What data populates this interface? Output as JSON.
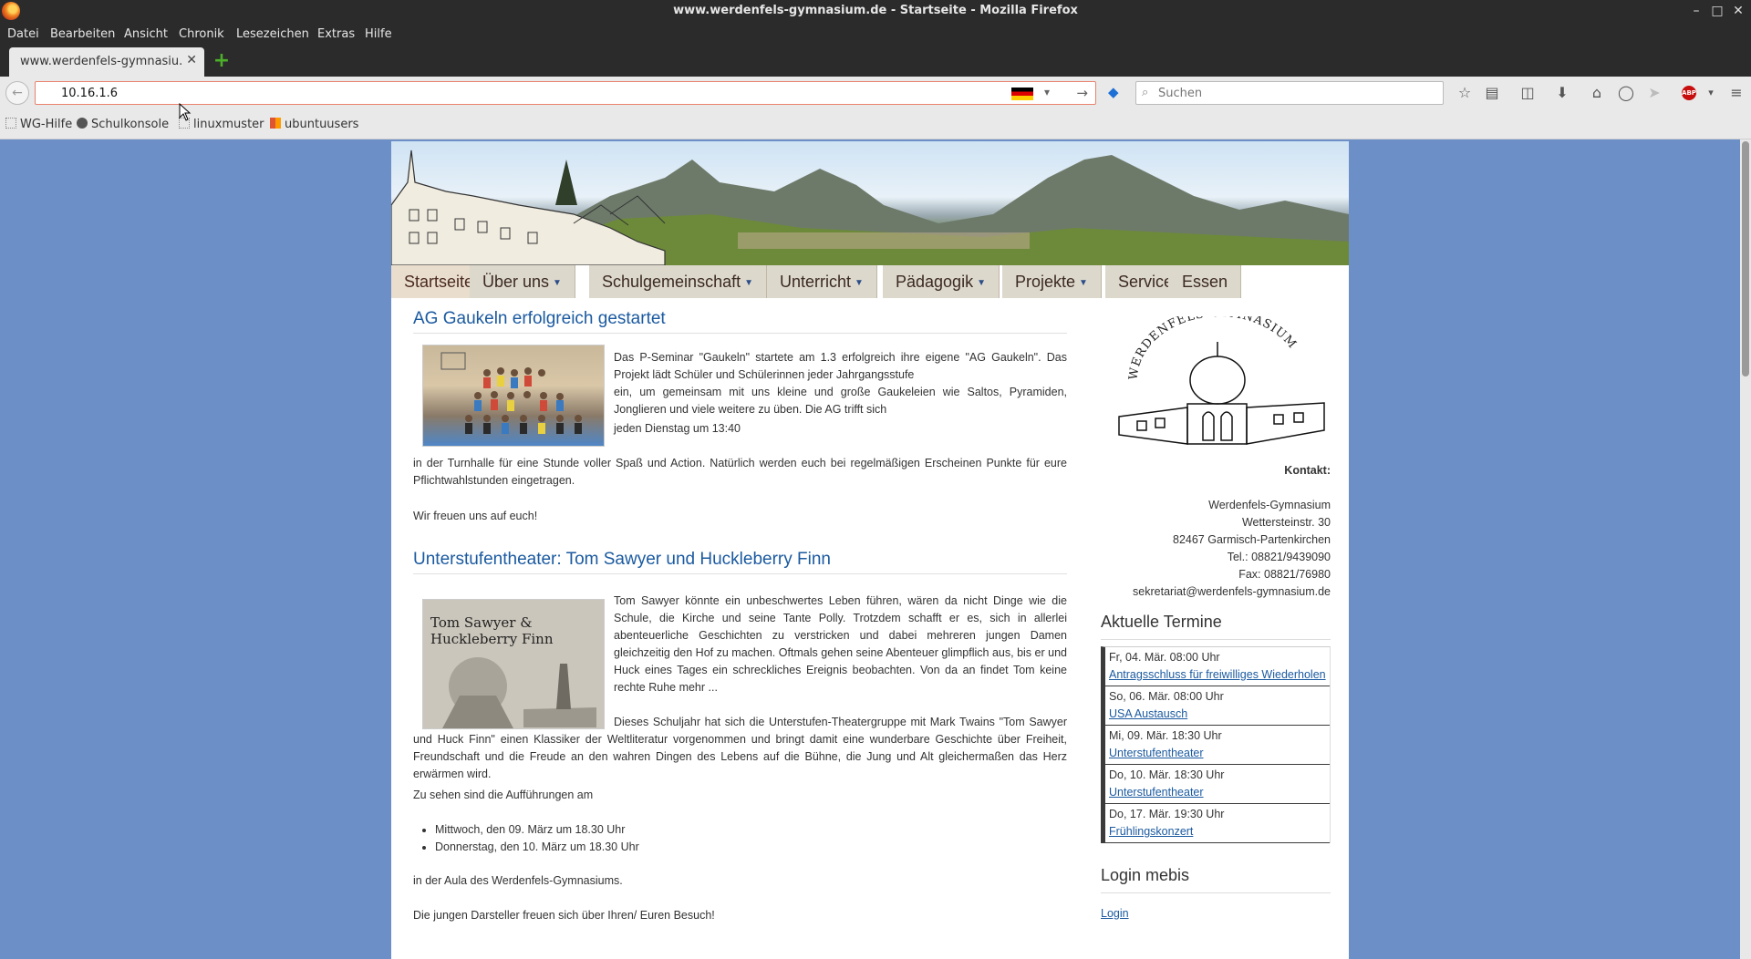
{
  "window": {
    "title": "www.werdenfels-gymnasium.de - Startseite - Mozilla Firefox"
  },
  "menu": [
    "Datei",
    "Bearbeiten",
    "Ansicht",
    "Chronik",
    "Lesezeichen",
    "Extras",
    "Hilfe"
  ],
  "tab": {
    "label": "www.werdenfels-gymnasiu...",
    "close": "✕"
  },
  "urlbar": {
    "value": "10.16.1.6"
  },
  "search": {
    "placeholder": "Suchen"
  },
  "bookmarks": [
    "WG-Hilfe",
    "Schulkonsole",
    "linuxmuster",
    "ubuntuusers"
  ],
  "nav": {
    "items": [
      {
        "label": "Startseite",
        "caret": false
      },
      {
        "label": "Über uns",
        "caret": true
      },
      {
        "label": "Schulgemeinschaft",
        "caret": true
      },
      {
        "label": "Unterricht",
        "caret": true
      },
      {
        "label": "Pädagogik",
        "caret": true
      },
      {
        "label": "Projekte",
        "caret": true
      },
      {
        "label": "Service",
        "caret": true
      },
      {
        "label": "Essen",
        "caret": false
      }
    ]
  },
  "articles": [
    {
      "title": "AG Gaukeln erfolgreich gestartet",
      "p1": "Das P-Seminar \"Gaukeln\" startete am 1.3 erfolgreich ihre eigene \"AG Gaukeln\". Das Projekt lädt Schüler und Schülerinnen jeder Jahrgangsstufe",
      "p2": "ein, um gemeinsam mit uns kleine und große Gaukeleien wie Saltos, Pyramiden, Jonglieren und viele weitere zu üben. Die AG trifft sich",
      "p3": "jeden Dienstag um 13:40",
      "p4": "in der Turnhalle für eine Stunde voller Spaß und Action. Natürlich werden euch bei regelmäßigen Erscheinen Punkte für eure Pflichtwahlstunden eingetragen.",
      "p5": "Wir freuen uns auf euch!"
    },
    {
      "title": "Unterstufentheater: Tom Sawyer und Huckleberry Finn",
      "image_text": "Tom Sawyer & Huckleberry Finn",
      "p1": "Tom Sawyer könnte ein unbeschwertes Leben führen, wären da nicht Dinge wie die Schule, die Kirche und seine Tante Polly. Trotzdem schafft er es, sich in allerlei abenteuerliche Geschichten zu verstricken und dabei mehreren jungen Damen gleichzeitig den Hof zu machen. Oftmals gehen seine Abenteuer glimpflich aus, bis er und Huck eines Tages ein schreckliches Ereignis beobachten. Von da an findet Tom keine rechte Ruhe mehr ...",
      "p2": "Dieses Schuljahr hat sich die Unterstufen-Theatergruppe mit Mark Twains \"Tom Sawyer und Huck Finn\" einen Klassiker der Weltliteratur vorgenommen und bringt damit eine wunderbare Geschichte über Freiheit,  Freundschaft und die Freude an den wahren Dingen des Lebens  auf die Bühne, die Jung und Alt gleichermaßen das Herz erwärmen wird.",
      "p3": "Zu sehen sind die Aufführungen am",
      "list": [
        "Mittwoch,  den 09. März um 18.30 Uhr",
        "Donnerstag, den 10. März um 18.30 Uhr"
      ],
      "p4": "in der Aula des Werdenfels-Gymnasiums.",
      "p5": "Die jungen Darsteller freuen sich über Ihren/ Euren Besuch!"
    }
  ],
  "sidebar": {
    "logo_text": "WERDENFELS-GYMNASIUM",
    "contact_label": "Kontakt:",
    "contact": [
      "Werdenfels-Gymnasium",
      "Wettersteinstr. 30",
      "82467 Garmisch-Partenkirchen",
      "Tel.: 08821/9439090",
      "Fax: 08821/76980",
      "sekretariat@werdenfels-gymnasium.de"
    ],
    "events_title": "Aktuelle Termine",
    "events": [
      {
        "date": "Fr, 04. Mär. 08:00 Uhr",
        "title": "Antragsschluss für freiwilliges Wiederholen"
      },
      {
        "date": "So, 06. Mär. 08:00 Uhr",
        "title": "USA Austausch"
      },
      {
        "date": "Mi, 09. Mär. 18:30 Uhr",
        "title": "Unterstufentheater"
      },
      {
        "date": "Do, 10. Mär. 18:30 Uhr",
        "title": "Unterstufentheater"
      },
      {
        "date": "Do, 17. Mär. 19:30 Uhr",
        "title": "Frühlingskonzert"
      }
    ],
    "login_title": "Login mebis",
    "login_link": "Login"
  },
  "colors": {
    "page_bg": "#6b8fc6",
    "link": "#1b5aa0",
    "nav_bg": "#ddd8cc"
  }
}
